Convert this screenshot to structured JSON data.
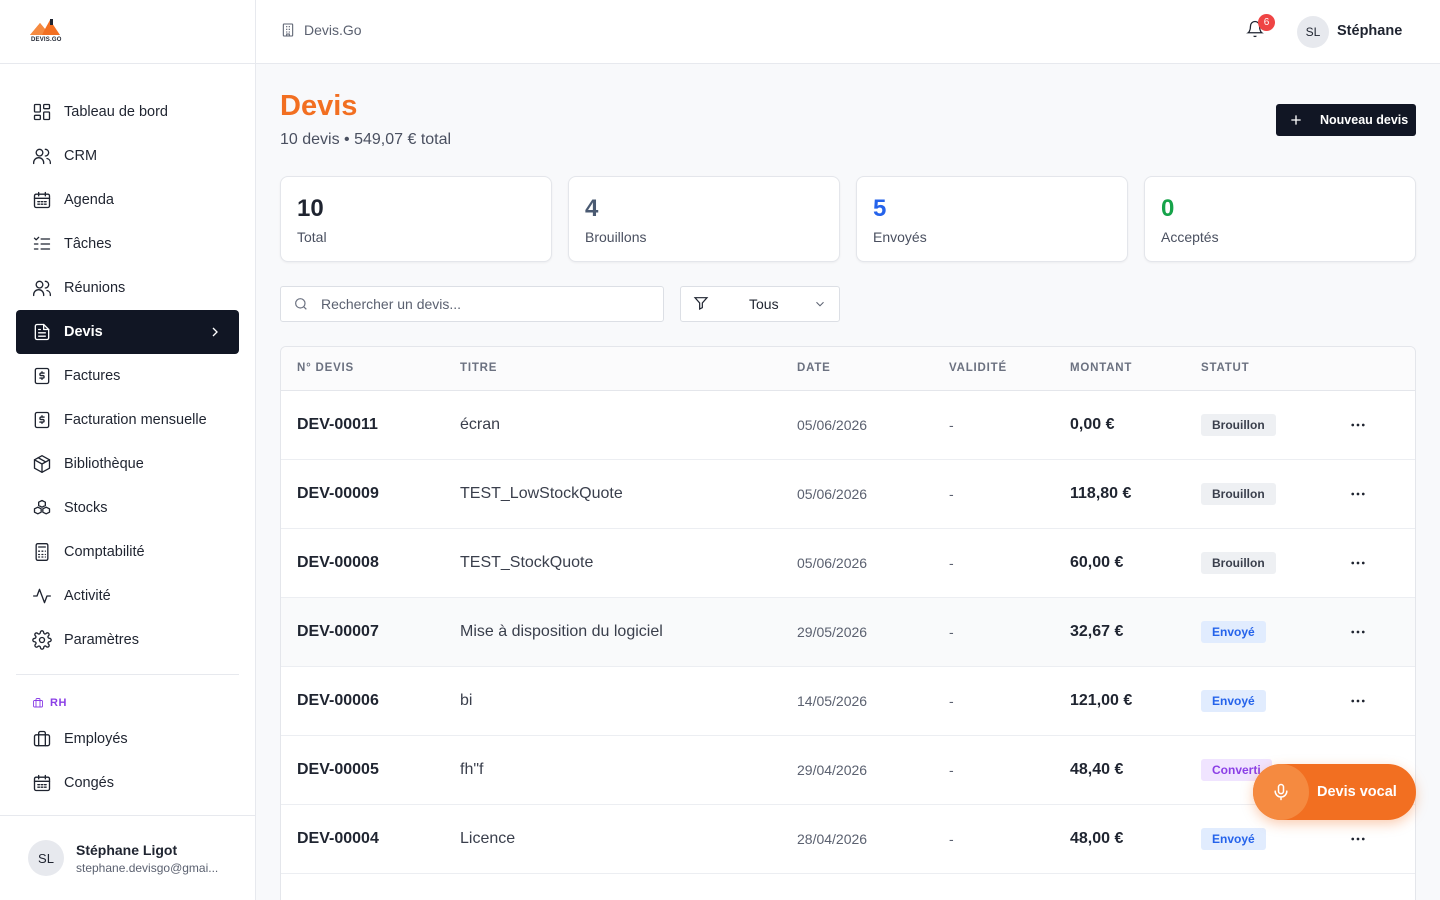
{
  "brand": {
    "logo_text": "DEVIS.GO",
    "accent": "#f26f21"
  },
  "sidebar": {
    "items": [
      {
        "label": "Tableau de bord",
        "icon": "dashboard-icon"
      },
      {
        "label": "CRM",
        "icon": "users-icon"
      },
      {
        "label": "Agenda",
        "icon": "calendar-icon"
      },
      {
        "label": "Tâches",
        "icon": "task-list-icon"
      },
      {
        "label": "Réunions",
        "icon": "meeting-icon"
      },
      {
        "label": "Devis",
        "icon": "document-icon",
        "active": true
      },
      {
        "label": "Factures",
        "icon": "invoice-icon"
      },
      {
        "label": "Facturation mensuelle",
        "icon": "monthly-billing-icon"
      },
      {
        "label": "Bibliothèque",
        "icon": "package-icon"
      },
      {
        "label": "Stocks",
        "icon": "boxes-icon"
      },
      {
        "label": "Comptabilité",
        "icon": "calculator-icon"
      },
      {
        "label": "Activité",
        "icon": "activity-icon"
      },
      {
        "label": "Paramètres",
        "icon": "gear-icon"
      }
    ],
    "section_rh": {
      "label": "RH",
      "icon": "briefcase-icon"
    },
    "rh_items": [
      {
        "label": "Employés",
        "icon": "briefcase-icon"
      },
      {
        "label": "Congés",
        "icon": "calendar-icon"
      }
    ],
    "user": {
      "initials": "SL",
      "name": "Stéphane Ligot",
      "email": "stephane.devisgo@gmai..."
    }
  },
  "topbar": {
    "breadcrumb": "Devis.Go",
    "notifications": "6",
    "user_initials": "SL",
    "user_name": "Stéphane"
  },
  "page": {
    "title": "Devis",
    "subtitle": "10 devis • 549,07 € total",
    "new_button": "Nouveau devis"
  },
  "stats": [
    {
      "value": "10",
      "label": "Total",
      "color": "#1f2430"
    },
    {
      "value": "4",
      "label": "Brouillons",
      "color": "#4a5a72"
    },
    {
      "value": "5",
      "label": "Envoyés",
      "color": "#2563eb"
    },
    {
      "value": "0",
      "label": "Acceptés",
      "color": "#16a34a"
    }
  ],
  "search": {
    "placeholder": "Rechercher un devis..."
  },
  "filter": {
    "value": "Tous"
  },
  "table": {
    "headers": {
      "num": "N° DEVIS",
      "title": "TITRE",
      "date": "DATE",
      "validity": "VALIDITÉ",
      "amount": "MONTANT",
      "status": "STATUT"
    },
    "rows": [
      {
        "num": "DEV-00011",
        "title": "écran",
        "date": "05/06/2026",
        "validity": "-",
        "amount": "0,00 €",
        "status": "Brouillon",
        "kind": "draft"
      },
      {
        "num": "DEV-00009",
        "title": "TEST_LowStockQuote",
        "date": "05/06/2026",
        "validity": "-",
        "amount": "118,80 €",
        "status": "Brouillon",
        "kind": "draft"
      },
      {
        "num": "DEV-00008",
        "title": "TEST_StockQuote",
        "date": "05/06/2026",
        "validity": "-",
        "amount": "60,00 €",
        "status": "Brouillon",
        "kind": "draft"
      },
      {
        "num": "DEV-00007",
        "title": "Mise à disposition du logiciel",
        "date": "29/05/2026",
        "validity": "-",
        "amount": "32,67 €",
        "status": "Envoyé",
        "kind": "sent",
        "highlight": true
      },
      {
        "num": "DEV-00006",
        "title": "bi",
        "date": "14/05/2026",
        "validity": "-",
        "amount": "121,00 €",
        "status": "Envoyé",
        "kind": "sent"
      },
      {
        "num": "DEV-00005",
        "title": "fh\"f",
        "date": "29/04/2026",
        "validity": "-",
        "amount": "48,40 €",
        "status": "Converti",
        "kind": "conv"
      },
      {
        "num": "DEV-00004",
        "title": "Licence",
        "date": "28/04/2026",
        "validity": "-",
        "amount": "48,00 €",
        "status": "Envoyé",
        "kind": "sent"
      }
    ]
  },
  "fab": {
    "label": "Devis vocal"
  }
}
